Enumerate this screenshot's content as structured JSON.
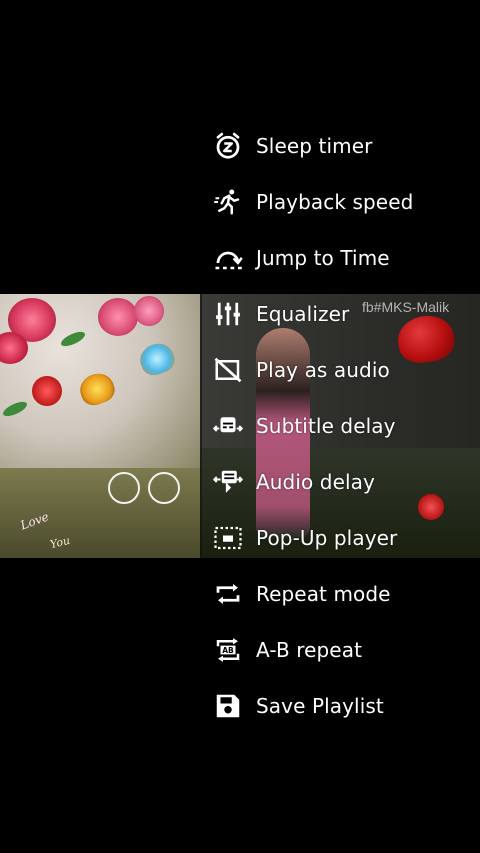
{
  "video": {
    "watermark": "fb#MKS-Malik",
    "overlay_text_1": "Love",
    "overlay_text_2": "You"
  },
  "menu": {
    "items": [
      {
        "label": "Sleep timer",
        "icon": "sleep-timer-icon"
      },
      {
        "label": "Playback speed",
        "icon": "running-person-icon"
      },
      {
        "label": "Jump to Time",
        "icon": "jump-arc-icon"
      },
      {
        "label": "Equalizer",
        "icon": "equalizer-sliders-icon"
      },
      {
        "label": "Play as audio",
        "icon": "video-off-icon"
      },
      {
        "label": "Subtitle delay",
        "icon": "subtitle-delay-icon"
      },
      {
        "label": "Audio delay",
        "icon": "audio-delay-icon"
      },
      {
        "label": "Pop-Up player",
        "icon": "popup-player-icon"
      },
      {
        "label": "Repeat mode",
        "icon": "repeat-icon"
      },
      {
        "label": "A-B repeat",
        "icon": "ab-repeat-icon"
      },
      {
        "label": "Save Playlist",
        "icon": "save-floppy-icon"
      }
    ]
  }
}
